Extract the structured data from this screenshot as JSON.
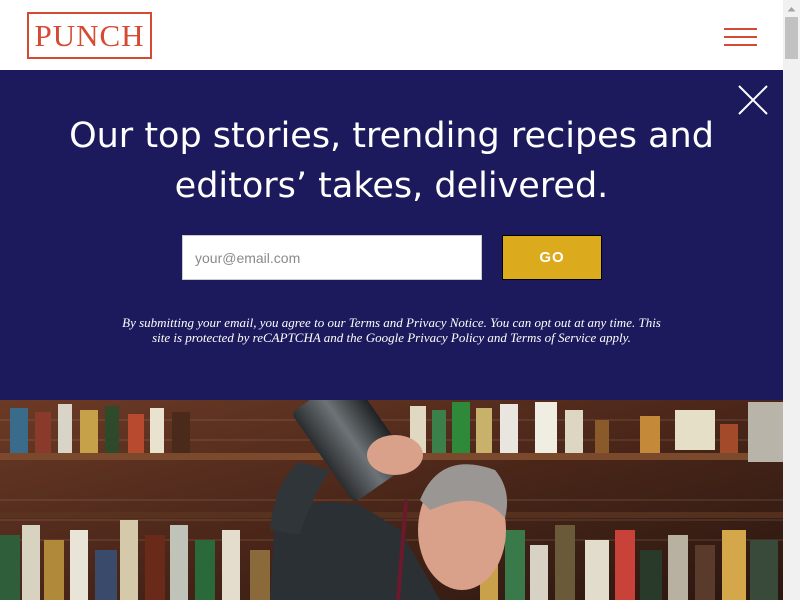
{
  "header": {
    "logo_text": "PUNCH",
    "menu_icon": "hamburger-menu-icon",
    "brand_color": "#d64933"
  },
  "newsletter": {
    "headline": "Our top stories, trending recipes and editors’ takes, delivered.",
    "email_placeholder": "your@email.com",
    "go_label": "GO",
    "disclaimer": "By submitting your email, you agree to our Terms and Privacy Notice. You can opt out at any time. This site is protected by reCAPTCHA and the Google Privacy Policy and Terms of Service apply.",
    "background_color": "#1c1a5d",
    "button_color": "#dcaa1d",
    "close_icon": "close-icon"
  },
  "hero": {
    "image_icon": "bartender-photo"
  }
}
